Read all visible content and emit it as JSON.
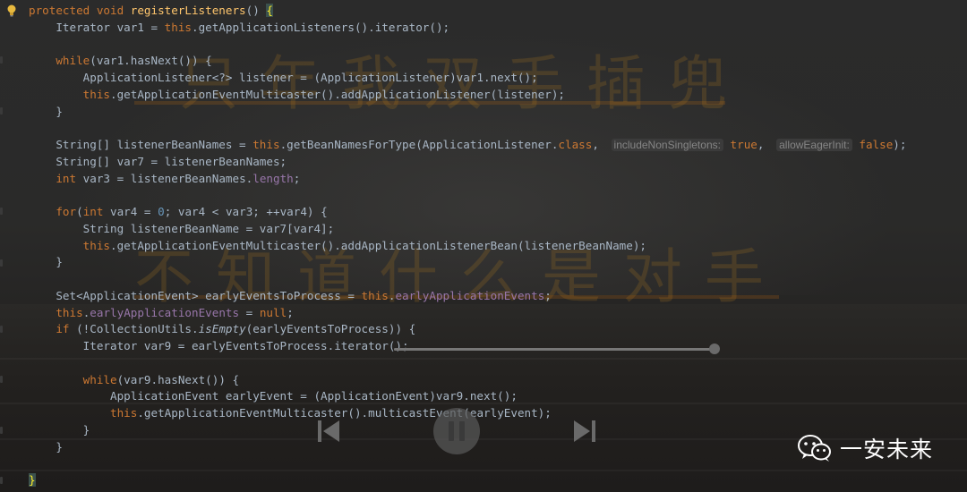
{
  "editor": {
    "lines": [
      [
        {
          "c": "kw",
          "t": "protected void "
        },
        {
          "c": "fn",
          "t": "registerListeners"
        },
        {
          "c": "",
          "t": "() "
        },
        {
          "c": "hl",
          "t": "{"
        }
      ],
      [
        {
          "c": "",
          "t": "    Iterator var1 = "
        },
        {
          "c": "kw",
          "t": "this"
        },
        {
          "c": "",
          "t": ".getApplicationListeners().iterator();"
        }
      ],
      [],
      [
        {
          "c": "",
          "t": "    "
        },
        {
          "c": "kw",
          "t": "while"
        },
        {
          "c": "",
          "t": "(var1.hasNext()) {"
        }
      ],
      [
        {
          "c": "",
          "t": "        ApplicationListener<?> listener = (ApplicationListener)var1.next();"
        }
      ],
      [
        {
          "c": "",
          "t": "        "
        },
        {
          "c": "kw",
          "t": "this"
        },
        {
          "c": "",
          "t": ".getApplicationEventMulticaster().addApplicationListener(listener);"
        }
      ],
      [
        {
          "c": "",
          "t": "    }"
        }
      ],
      [],
      [
        {
          "c": "",
          "t": "    String[] listenerBeanNames = "
        },
        {
          "c": "kw",
          "t": "this"
        },
        {
          "c": "",
          "t": ".getBeanNamesForType(ApplicationListener."
        },
        {
          "c": "kw",
          "t": "class"
        },
        {
          "c": "",
          "t": ", "
        },
        {
          "c": "hint",
          "t": "includeNonSingletons:"
        },
        {
          "c": "",
          "t": " "
        },
        {
          "c": "kw",
          "t": "true"
        },
        {
          "c": "",
          "t": ", "
        },
        {
          "c": "hint",
          "t": "allowEagerInit:"
        },
        {
          "c": "",
          "t": " "
        },
        {
          "c": "kw",
          "t": "false"
        },
        {
          "c": "",
          "t": ");"
        }
      ],
      [
        {
          "c": "",
          "t": "    String[] var7 = listenerBeanNames;"
        }
      ],
      [
        {
          "c": "",
          "t": "    "
        },
        {
          "c": "kw",
          "t": "int"
        },
        {
          "c": "",
          "t": " var3 = listenerBeanNames."
        },
        {
          "c": "fld",
          "t": "length"
        },
        {
          "c": "",
          "t": ";"
        }
      ],
      [],
      [
        {
          "c": "",
          "t": "    "
        },
        {
          "c": "kw",
          "t": "for"
        },
        {
          "c": "",
          "t": "("
        },
        {
          "c": "kw",
          "t": "int"
        },
        {
          "c": "",
          "t": " var4 = "
        },
        {
          "c": "num",
          "t": "0"
        },
        {
          "c": "",
          "t": "; var4 < var3; ++var4) {"
        }
      ],
      [
        {
          "c": "",
          "t": "        String listenerBeanName = var7[var4];"
        }
      ],
      [
        {
          "c": "",
          "t": "        "
        },
        {
          "c": "kw",
          "t": "this"
        },
        {
          "c": "",
          "t": ".getApplicationEventMulticaster().addApplicationListenerBean(listenerBeanName);"
        }
      ],
      [
        {
          "c": "",
          "t": "    }"
        }
      ],
      [],
      [
        {
          "c": "",
          "t": "    Set<ApplicationEvent> earlyEventsToProcess = "
        },
        {
          "c": "kw",
          "t": "this"
        },
        {
          "c": "",
          "t": "."
        },
        {
          "c": "fld",
          "t": "earlyApplicationEvents"
        },
        {
          "c": "",
          "t": ";"
        }
      ],
      [
        {
          "c": "",
          "t": "    "
        },
        {
          "c": "kw",
          "t": "this"
        },
        {
          "c": "",
          "t": "."
        },
        {
          "c": "fld",
          "t": "earlyApplicationEvents"
        },
        {
          "c": "",
          "t": " = "
        },
        {
          "c": "kw",
          "t": "null"
        },
        {
          "c": "",
          "t": ";"
        }
      ],
      [
        {
          "c": "",
          "t": "    "
        },
        {
          "c": "kw",
          "t": "if"
        },
        {
          "c": "",
          "t": " (!CollectionUtils."
        },
        {
          "c": "it",
          "t": "isEmpty"
        },
        {
          "c": "",
          "t": "(earlyEventsToProcess)) {"
        }
      ],
      [
        {
          "c": "",
          "t": "        Iterator var9 = earlyEventsToProcess.iterator();"
        }
      ],
      [],
      [
        {
          "c": "",
          "t": "        "
        },
        {
          "c": "kw",
          "t": "while"
        },
        {
          "c": "",
          "t": "(var9.hasNext()) {"
        }
      ],
      [
        {
          "c": "",
          "t": "            ApplicationEvent earlyEvent = (ApplicationEvent)var9.next();"
        }
      ],
      [
        {
          "c": "",
          "t": "            "
        },
        {
          "c": "kw",
          "t": "this"
        },
        {
          "c": "",
          "t": ".getApplicationEventMulticaster().multicastEvent(earlyEvent);"
        }
      ],
      [
        {
          "c": "",
          "t": "        }"
        }
      ],
      [
        {
          "c": "",
          "t": "    }"
        }
      ],
      [],
      [
        {
          "c": "",
          "t": ""
        },
        {
          "c": "hl",
          "t": "}"
        }
      ]
    ]
  },
  "watermark": {
    "line1": "只 年 我 双 手 插 兜",
    "line2": "不 知 道 什 么 是 对 手"
  },
  "player": {
    "progress": 0.99
  },
  "brand": {
    "name": "一安未来"
  },
  "colors": {
    "keyword": "#cc7832",
    "method": "#ffc66d",
    "number": "#6897bb",
    "field": "#9876aa",
    "text": "#a9b7c6",
    "background": "#2b2b2b"
  }
}
